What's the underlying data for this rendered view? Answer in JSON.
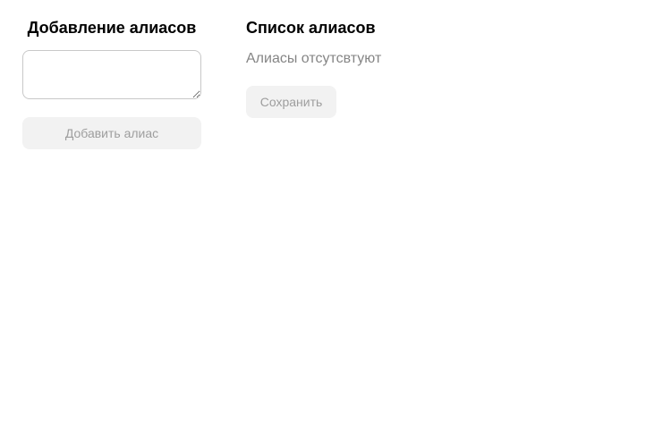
{
  "add_section": {
    "title": "Добавление алиасов",
    "textarea_value": "",
    "add_button_label": "Добавить алиас"
  },
  "list_section": {
    "title": "Список алиасов",
    "empty_text": "Алиасы отсутсвтуют",
    "save_button_label": "Сохранить"
  },
  "colors": {
    "button_bg": "#f2f2f2",
    "button_text_disabled": "#9e9e9e",
    "muted_text": "#858585",
    "border": "#c8c8c8"
  }
}
